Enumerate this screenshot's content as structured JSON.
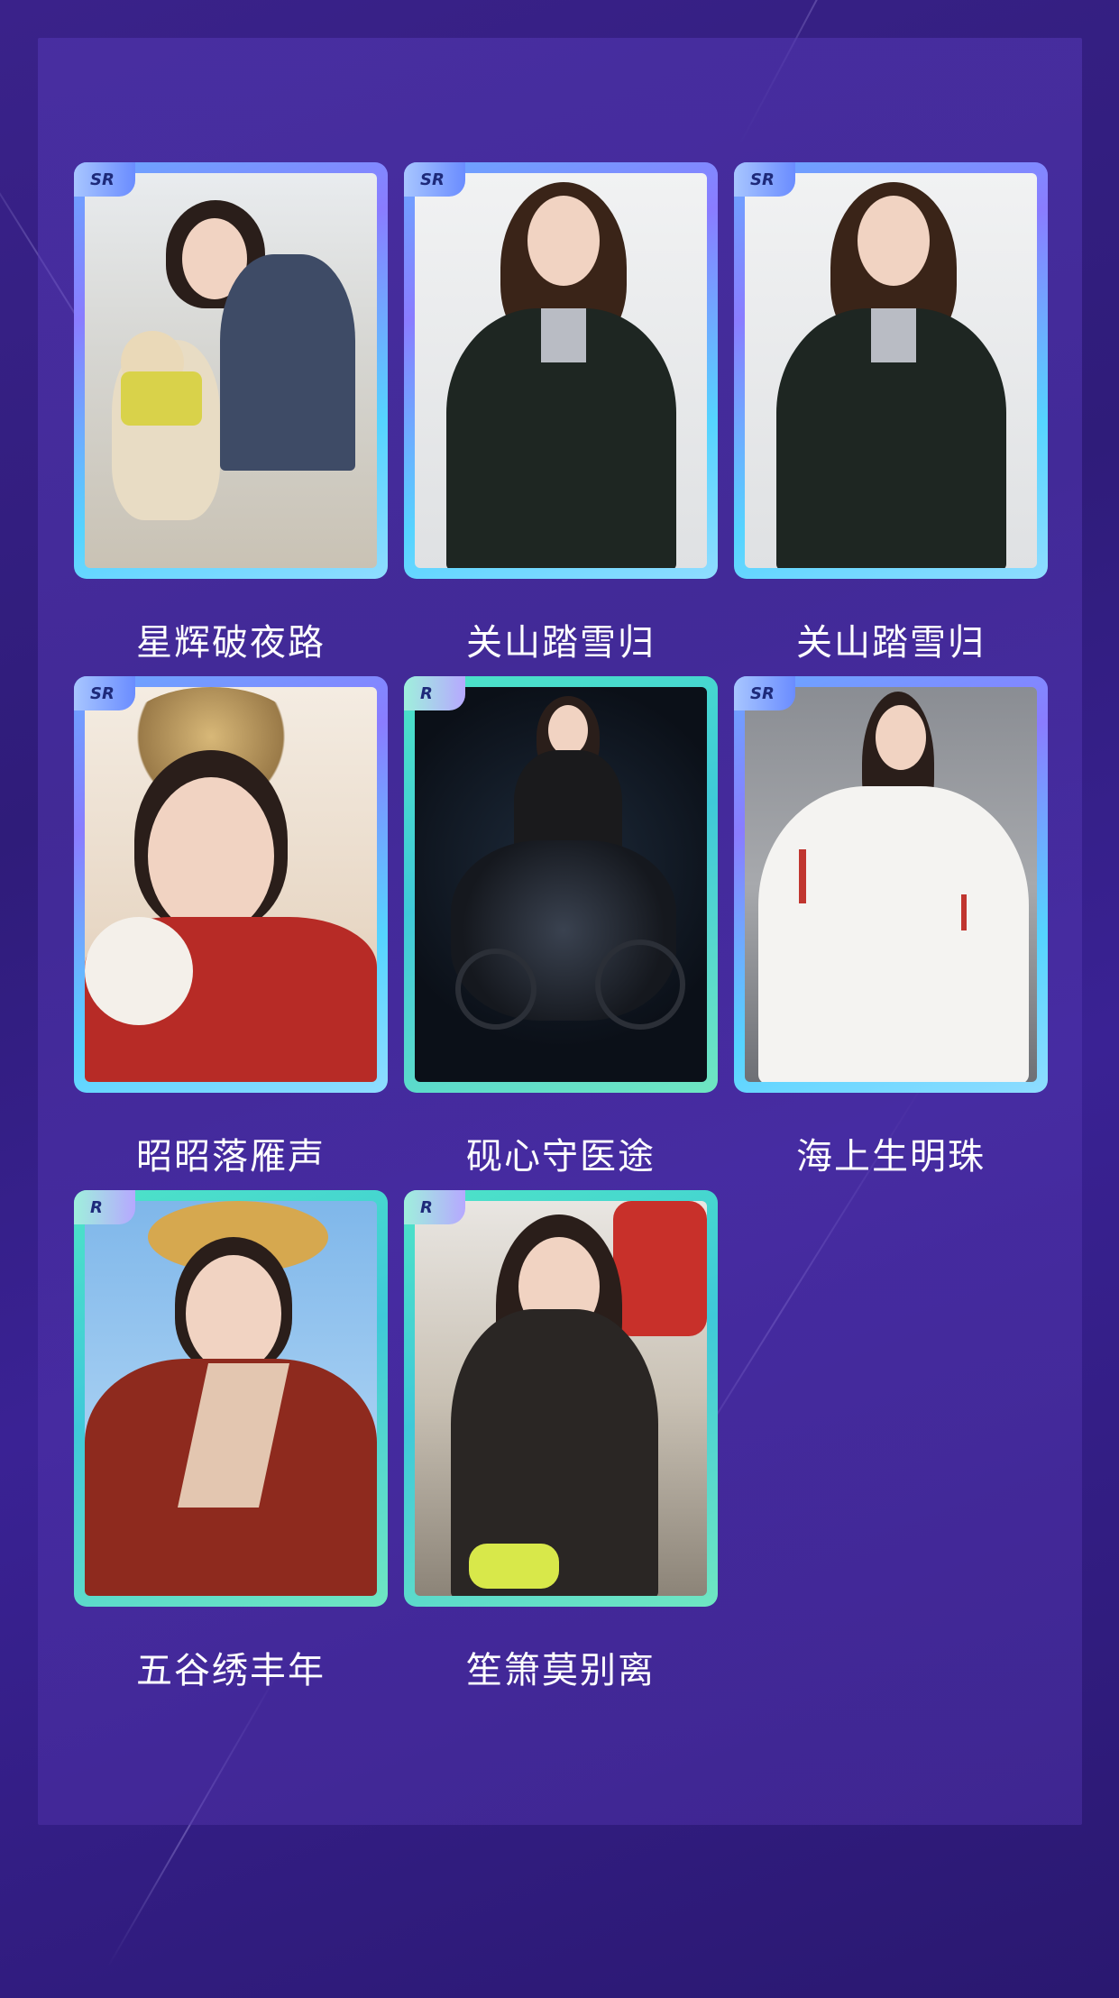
{
  "colors": {
    "background": "#321e80",
    "panel": "#4a33a6",
    "sr_frame": "#6aa8ff",
    "r_frame": "#4de3c7",
    "caption": "#ffffff"
  },
  "cards": [
    {
      "rarity": "SR",
      "title": "星辉破夜路"
    },
    {
      "rarity": "SR",
      "title": "关山踏雪归"
    },
    {
      "rarity": "SR",
      "title": "关山踏雪归"
    },
    {
      "rarity": "SR",
      "title": "昭昭落雁声"
    },
    {
      "rarity": "R",
      "title": "砚心守医途"
    },
    {
      "rarity": "SR",
      "title": "海上生明珠"
    },
    {
      "rarity": "R",
      "title": "五谷绣丰年"
    },
    {
      "rarity": "R",
      "title": "笙箫莫别离"
    }
  ]
}
